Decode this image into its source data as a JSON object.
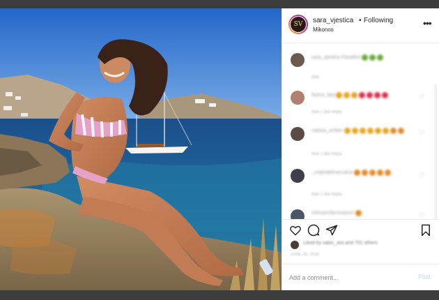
{
  "post": {
    "username": "sara_vjestica",
    "separator": "•",
    "follow_status": "Following",
    "location": "Mikonos",
    "avatar_initials": "SV",
    "more_icon": "more-horizontal-icon"
  },
  "comments": [
    {
      "text": "sara_vjestica Paradise",
      "emojis": [
        "green",
        "green",
        "green"
      ],
      "meta": "85w",
      "avatar_color": "#6b5a4e"
    },
    {
      "text": "fasina_bjoj",
      "emojis": [
        "gold",
        "gold",
        "gold",
        "red",
        "red",
        "red",
        "red"
      ],
      "meta": "85w   1 like   Reply",
      "avatar_color": "#b08070"
    },
    {
      "text": "natasa_amber",
      "emojis": [
        "gold",
        "gold",
        "gold",
        "gold",
        "gold",
        "gold",
        "orange",
        "orange"
      ],
      "meta": "85w   1 like   Reply",
      "avatar_color": "#5c4a44"
    },
    {
      "text": "_cvijetaleksanzana",
      "emojis": [
        "orange",
        "orange",
        "orange",
        "orange",
        "orange"
      ],
      "meta": "85w   1 like   Reply",
      "avatar_color": "#3d3f4a"
    },
    {
      "text": "milosamilanovasovi",
      "emojis": [
        "orange"
      ],
      "meta": "",
      "avatar_color": "#4a5566"
    }
  ],
  "likes": {
    "text": "Liked by sabic_ara and 701 others"
  },
  "date": "JUNE 28, 2019",
  "add_comment": {
    "placeholder": "Add a comment...",
    "post_label": "Post"
  },
  "colors": {
    "link_disabled": "#b2dffc",
    "text": "#262626",
    "muted": "#8e8e8e"
  }
}
